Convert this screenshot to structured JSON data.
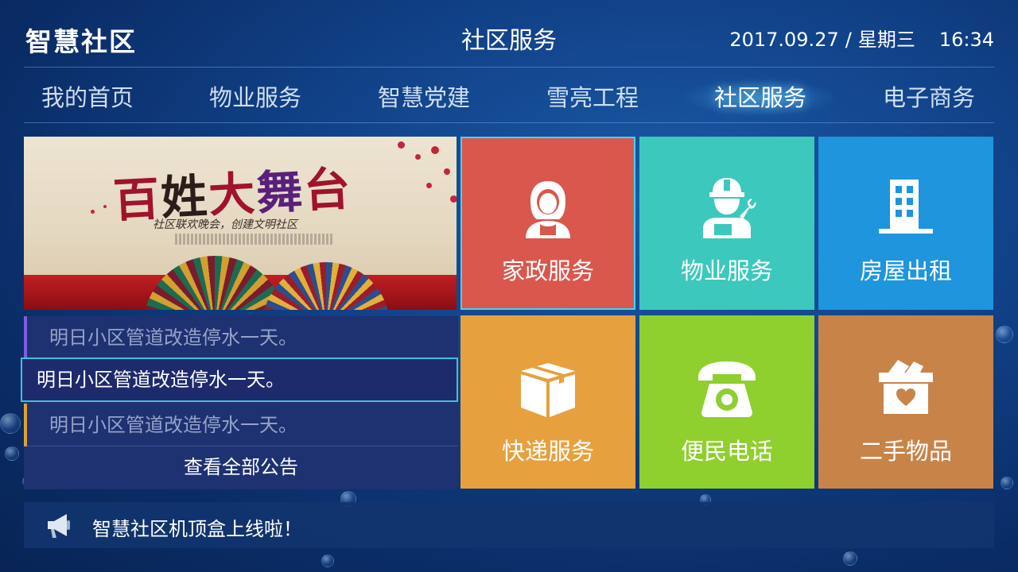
{
  "header": {
    "app_title": "智慧社区",
    "page_title": "社区服务",
    "date": "2017.09.27",
    "separator": "/",
    "weekday": "星期三",
    "time": "16:34"
  },
  "nav": {
    "items": [
      {
        "label": "我的首页"
      },
      {
        "label": "物业服务"
      },
      {
        "label": "智慧党建"
      },
      {
        "label": "雪亮工程"
      },
      {
        "label": "社区服务"
      },
      {
        "label": "电子商务"
      }
    ],
    "active": "社区服务"
  },
  "banner": {
    "title_chars": [
      "百",
      "姓",
      "大",
      "舞",
      "台"
    ],
    "subtitle": "社区联欢晚会，创建文明社区"
  },
  "notices": {
    "items": [
      {
        "text": "明日小区管道改造停水一天。",
        "accent": "#7b5fe0"
      },
      {
        "text": "明日小区管道改造停水一天。",
        "accent": ""
      },
      {
        "text": "明日小区管道改造停水一天。",
        "accent": "#e0a030"
      }
    ],
    "view_all": "查看全部公告"
  },
  "services": [
    {
      "label": "家政服务",
      "icon": "housekeeper-icon",
      "color": "#d9574c"
    },
    {
      "label": "物业服务",
      "icon": "repairman-icon",
      "color": "#3cc8bc"
    },
    {
      "label": "房屋出租",
      "icon": "building-icon",
      "color": "#1e95dc"
    },
    {
      "label": "快递服务",
      "icon": "package-icon",
      "color": "#e6a13e"
    },
    {
      "label": "便民电话",
      "icon": "telephone-icon",
      "color": "#8fcf2e"
    },
    {
      "label": "二手物品",
      "icon": "secondhand-box-icon",
      "color": "#c88348"
    }
  ],
  "ticker": {
    "icon": "megaphone-icon",
    "text": "智慧社区机顶盒上线啦！"
  }
}
